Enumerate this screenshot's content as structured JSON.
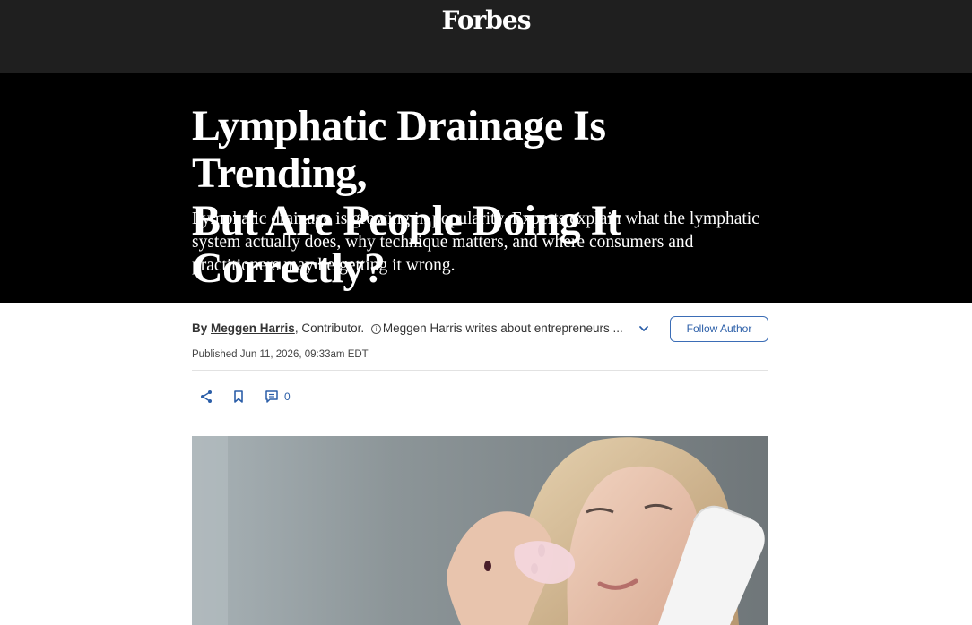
{
  "header": {
    "logo": "Forbes"
  },
  "article": {
    "headline_line1": "Lymphatic Drainage Is Trending,",
    "headline_line2": "But Are People Doing It Correctly?",
    "dek": "Lymphatic drainage is growing in popularity. Experts explain what the lymphatic system actually does, why technique matters, and where consumers and practitioners may be getting it wrong.",
    "byline": {
      "by_label": "By",
      "author": "Meggen Harris",
      "role": "Contributor.",
      "info_icon": "info-icon",
      "bio": "Meggen Harris writes about entrepreneurs ...",
      "follow_label": "Follow Author"
    },
    "published": "Published Jun 11, 2026, 09:33am EDT",
    "actions": {
      "share_icon": "share-icon",
      "bookmark_icon": "bookmark-icon",
      "comment_icon": "comment-icon",
      "comment_count": "0"
    }
  },
  "colors": {
    "topbar": "#1f1f1f",
    "hero": "#000000",
    "accent": "#2b5ea8"
  }
}
